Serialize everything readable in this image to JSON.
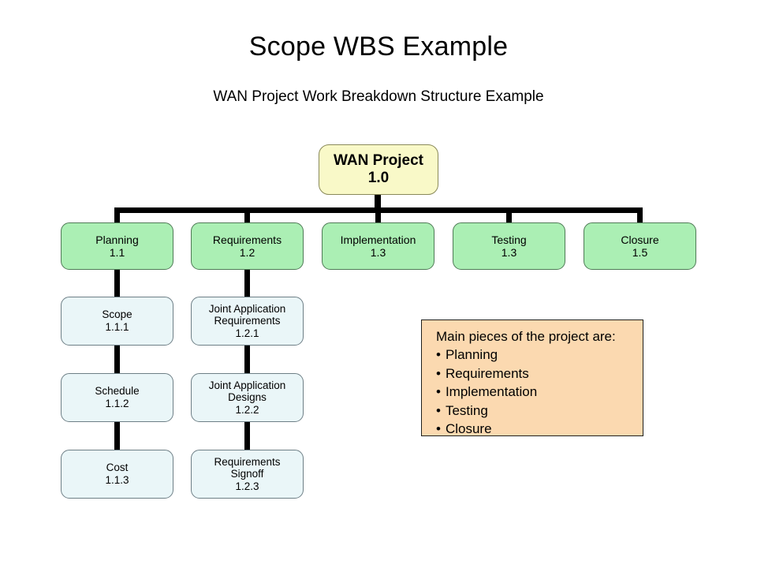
{
  "page": {
    "title": "Scope WBS Example",
    "subtitle": "WAN Project Work Breakdown Structure Example"
  },
  "diagram": {
    "type": "work-breakdown-structure",
    "root": {
      "name": "WAN Project",
      "code": "1.0"
    },
    "level2": [
      {
        "name": "Planning",
        "code": "1.1"
      },
      {
        "name": "Requirements",
        "code": "1.2"
      },
      {
        "name": "Implementation",
        "code": "1.3"
      },
      {
        "name": "Testing",
        "code": "1.3"
      },
      {
        "name": "Closure",
        "code": "1.5"
      }
    ],
    "planning_children": [
      {
        "name": "Scope",
        "code": "1.1.1"
      },
      {
        "name": "Schedule",
        "code": "1.1.2"
      },
      {
        "name": "Cost",
        "code": "1.1.3"
      }
    ],
    "requirements_children": [
      {
        "name_line1": "Joint Application",
        "name_line2": "Requirements",
        "code": "1.2.1"
      },
      {
        "name_line1": "Joint Application",
        "name_line2": "Designs",
        "code": "1.2.2"
      },
      {
        "name_line1": "Requirements",
        "name_line2": "Signoff",
        "code": "1.2.3"
      }
    ]
  },
  "callout": {
    "heading": "Main pieces of the project are:",
    "items": [
      "Planning",
      "Requirements",
      "Implementation",
      "Testing",
      "Closure"
    ]
  },
  "colors": {
    "root_fill": "#f9f9c8",
    "level2_fill": "#abefb4",
    "level3_fill": "#eaf6f8",
    "callout_fill": "#fbd9b0",
    "connector": "#000000"
  }
}
